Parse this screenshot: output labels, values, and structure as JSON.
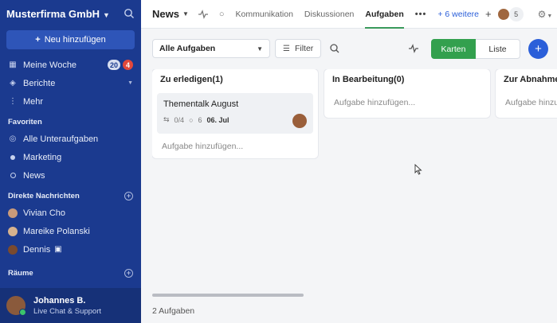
{
  "sidebar": {
    "org_name": "Musterfirma GmbH",
    "new_button": "Neu hinzufügen",
    "nav": [
      {
        "label": "Meine Woche",
        "badge1": "20",
        "badge2": "4"
      },
      {
        "label": "Berichte"
      },
      {
        "label": "Mehr"
      }
    ],
    "favorites_title": "Favoriten",
    "favorites": [
      {
        "label": "Alle Unteraufgaben"
      },
      {
        "label": "Marketing"
      },
      {
        "label": "News"
      }
    ],
    "dm_title": "Direkte Nachrichten",
    "dms": [
      {
        "label": "Vivian Cho"
      },
      {
        "label": "Mareike Polanski"
      },
      {
        "label": "Dennis"
      }
    ],
    "rooms_title": "Räume",
    "user": {
      "name": "Johannes B.",
      "status_dot": "·",
      "subtitle": "Live Chat & Support"
    }
  },
  "topbar": {
    "title": "News",
    "tabs": [
      {
        "label": "Kommunikation"
      },
      {
        "label": "Diskussionen"
      },
      {
        "label": "Aufgaben"
      }
    ],
    "more_tabs": "+ 6 weitere",
    "add": "+",
    "member_count": "5"
  },
  "toolbar": {
    "select_value": "Alle Aufgaben",
    "filter_label": "Filter",
    "view_cards": "Karten",
    "view_list": "Liste",
    "fab": "+"
  },
  "board": {
    "columns": [
      {
        "title": "Zu erledigen(1)",
        "add_label": "Aufgabe hinzufügen..."
      },
      {
        "title": "In Bearbeitung(0)",
        "add_label": "Aufgabe hinzufügen..."
      },
      {
        "title": "Zur Abnahme",
        "add_label": "Aufgabe hinzufügen..."
      }
    ],
    "card": {
      "title": "Thementalk August",
      "subtasks": "0/4",
      "comments": "6",
      "date": "06. Jul"
    }
  },
  "footer": {
    "task_count": "2 Aufgaben"
  },
  "colors": {
    "sidebar": "#1b3a8f",
    "accent_green": "#33a04e",
    "accent_blue": "#2b5fd9",
    "badge_red": "#e2483b"
  }
}
